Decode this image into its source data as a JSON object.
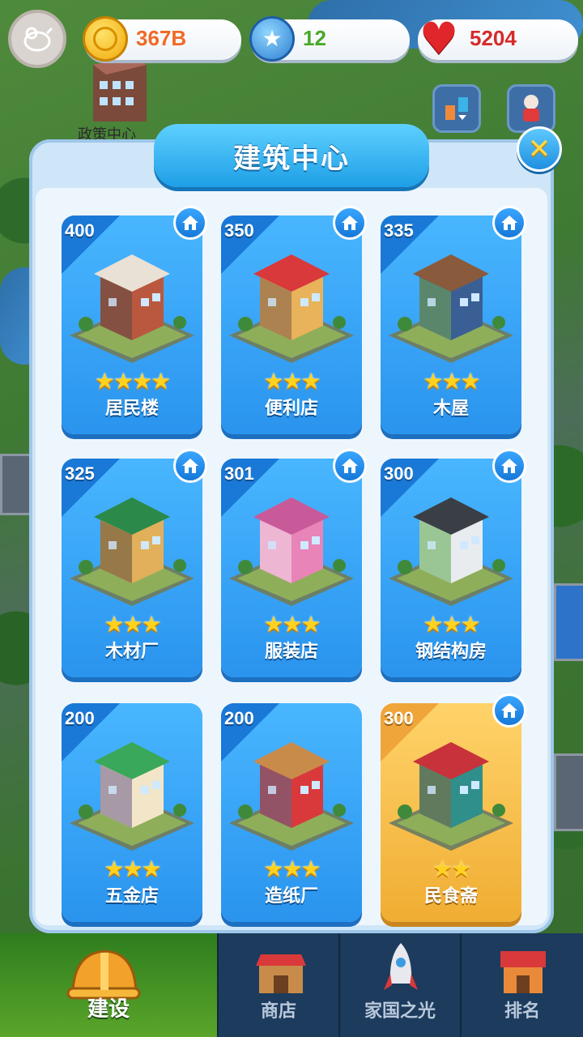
{
  "resources": {
    "coins": "367B",
    "stars": "12",
    "hearts": "5204"
  },
  "background_label": "政策中心",
  "dialog": {
    "title": "建筑中心"
  },
  "buildings": [
    {
      "price": "400",
      "name": "居民楼",
      "stars": 4,
      "style": "blue",
      "home_badge": true
    },
    {
      "price": "350",
      "name": "便利店",
      "stars": 3,
      "style": "blue",
      "home_badge": true
    },
    {
      "price": "335",
      "name": "木屋",
      "stars": 3,
      "style": "blue",
      "home_badge": true
    },
    {
      "price": "325",
      "name": "木材厂",
      "stars": 3,
      "style": "blue",
      "home_badge": true
    },
    {
      "price": "301",
      "name": "服装店",
      "stars": 3,
      "style": "blue",
      "home_badge": true
    },
    {
      "price": "300",
      "name": "钢结构房",
      "stars": 3,
      "style": "blue",
      "home_badge": true
    },
    {
      "price": "200",
      "name": "五金店",
      "stars": 3,
      "style": "blue",
      "home_badge": false
    },
    {
      "price": "200",
      "name": "造纸厂",
      "stars": 3,
      "style": "blue",
      "home_badge": false
    },
    {
      "price": "300",
      "name": "民食斋",
      "stars": 2,
      "style": "gold",
      "home_badge": true
    }
  ],
  "nav": {
    "build": "建设",
    "shop": "商店",
    "homeland": "家国之光",
    "rank": "排名"
  },
  "colors": {
    "card_blue": "#2a94ee",
    "card_gold": "#f0ad33",
    "coin_text": "#f06a28",
    "star_text": "#4aa82a",
    "heart_text": "#d62a2a"
  }
}
